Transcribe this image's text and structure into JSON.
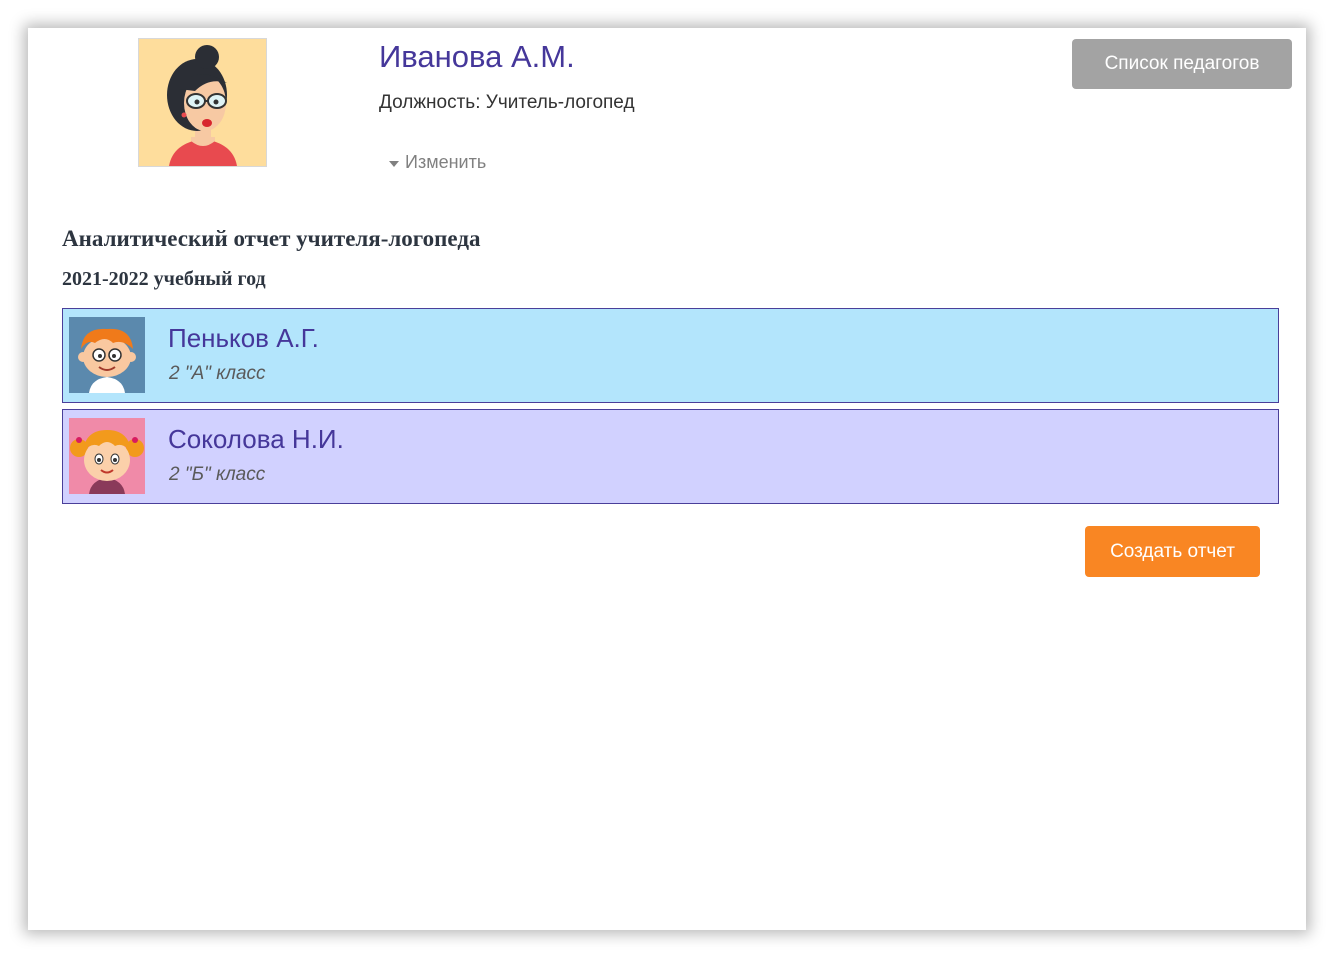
{
  "teacher": {
    "name": "Иванова А.М.",
    "position_label": "Должность: Учитель-логопед",
    "edit_label": "Изменить",
    "avatar_icon": "teacher-avatar-icon"
  },
  "header": {
    "teachers_button_label": "Список педагогов"
  },
  "report": {
    "title": "Аналитический отчет учителя-логопеда",
    "year": "2021-2022 учебный год"
  },
  "students": [
    {
      "name": "Пеньков А.Г.",
      "class": "2 \"А\" класс",
      "color": "#b3e5fc",
      "avatar_icon": "boy-avatar-icon"
    },
    {
      "name": "Соколова Н.И.",
      "class": "2 \"Б\" класс",
      "color": "#d1d1ff",
      "avatar_icon": "girl-avatar-icon"
    }
  ],
  "actions": {
    "create_label": "Создать отчет"
  },
  "colors": {
    "accent": "#45379a",
    "create_button": "#f98623",
    "teachers_button": "#a3a3a3"
  }
}
